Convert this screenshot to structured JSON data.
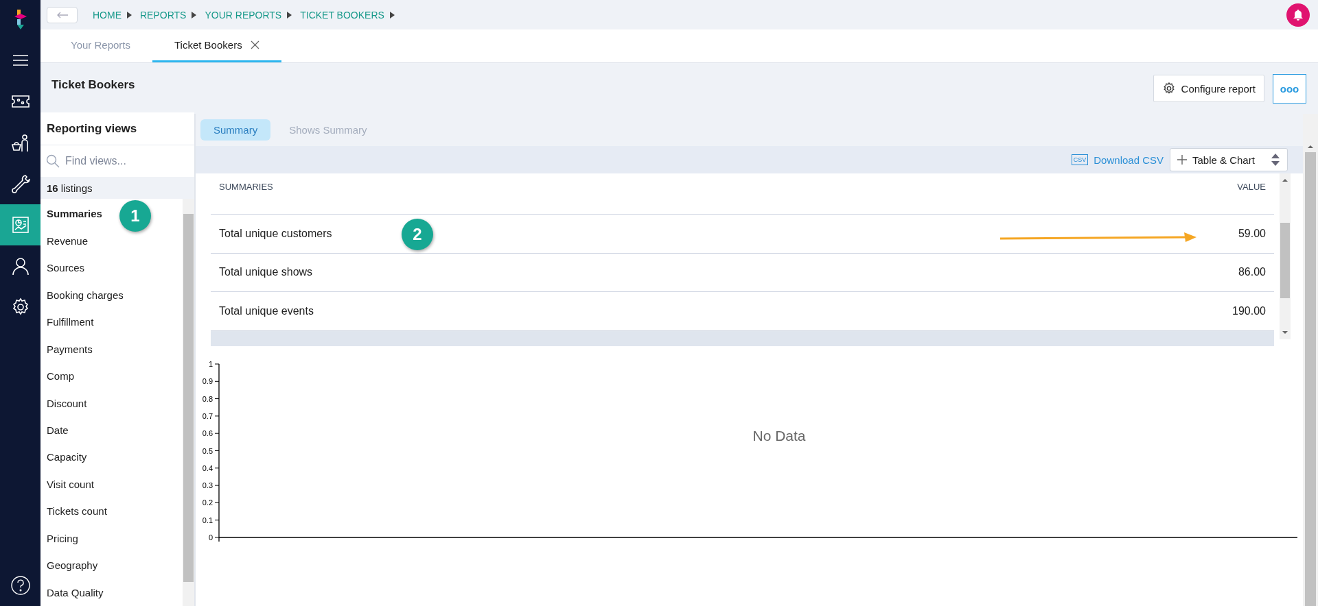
{
  "rail": {
    "items": [
      {
        "selected": false
      },
      {
        "selected": false
      },
      {
        "selected": false
      },
      {
        "selected": false
      },
      {
        "selected": true
      },
      {
        "selected": false
      },
      {
        "selected": false
      }
    ]
  },
  "breadcrumb": [
    "HOME",
    "REPORTS",
    "YOUR REPORTS",
    "TICKET BOOKERS"
  ],
  "tabs": [
    {
      "label": "Your Reports",
      "selected": false,
      "closable": false
    },
    {
      "label": "Ticket Bookers",
      "selected": true,
      "closable": true
    }
  ],
  "header": {
    "title": "Ticket Bookers",
    "configure_button": "Configure report",
    "more_button": "ooo"
  },
  "sidebar": {
    "title": "Reporting views",
    "search": {
      "placeholder": "Find views..."
    },
    "count": "16",
    "count_label": "listings",
    "items": [
      {
        "label": "Summaries",
        "selected": true
      },
      {
        "label": "Revenue",
        "selected": false
      },
      {
        "label": "Sources",
        "selected": false
      },
      {
        "label": "Booking charges",
        "selected": false
      },
      {
        "label": "Fulfillment",
        "selected": false
      },
      {
        "label": "Payments",
        "selected": false
      },
      {
        "label": "Comp",
        "selected": false
      },
      {
        "label": "Discount",
        "selected": false
      },
      {
        "label": "Date",
        "selected": false
      },
      {
        "label": "Capacity",
        "selected": false
      },
      {
        "label": "Visit count",
        "selected": false
      },
      {
        "label": "Tickets count",
        "selected": false
      },
      {
        "label": "Pricing",
        "selected": false
      },
      {
        "label": "Geography",
        "selected": false
      },
      {
        "label": "Data Quality",
        "selected": false
      }
    ]
  },
  "view_tabs": [
    {
      "label": "Summary",
      "selected": true
    },
    {
      "label": "Shows Summary",
      "selected": false
    }
  ],
  "toolbar": {
    "csv_icon_text": "CSV",
    "download": "Download CSV",
    "display_select": "Table & Chart"
  },
  "table": {
    "columns": [
      "SUMMARIES",
      "VALUE"
    ],
    "rows": [
      [
        "Total unique customers",
        "59.00"
      ],
      [
        "Total unique shows",
        "86.00"
      ],
      [
        "Total unique events",
        "190.00"
      ]
    ]
  },
  "chart": {
    "y_tick_labels": [
      "1",
      "0.9",
      "0.8",
      "0.7",
      "0.6",
      "0.5",
      "0.4",
      "0.3",
      "0.2",
      "0.1",
      "0"
    ],
    "empty_message": "No Data"
  },
  "annotations": [
    "1",
    "2"
  ]
}
